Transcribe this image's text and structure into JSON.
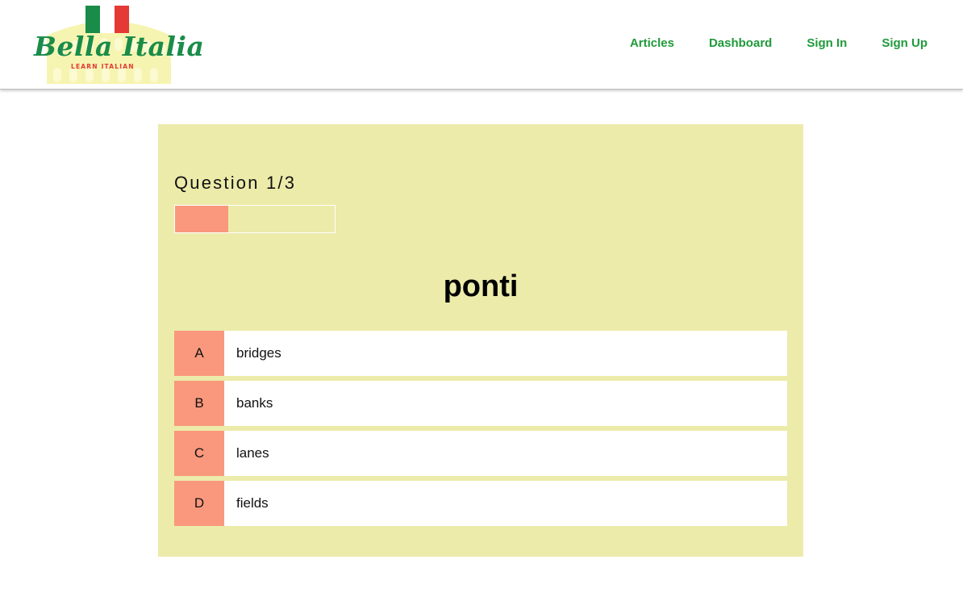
{
  "header": {
    "logo": {
      "title": "Bella Italia",
      "subtitle": "LEARN ITALIAN",
      "flag_colors": [
        "#1a8c4a",
        "#ffffff",
        "#e53935"
      ]
    },
    "nav": [
      {
        "label": "Articles"
      },
      {
        "label": "Dashboard"
      },
      {
        "label": "Sign In"
      },
      {
        "label": "Sign Up"
      }
    ]
  },
  "quiz": {
    "question_label": "Question 1/3",
    "progress": 0.333,
    "word": "ponti",
    "options": [
      {
        "letter": "A",
        "text": "bridges"
      },
      {
        "letter": "B",
        "text": "banks"
      },
      {
        "letter": "C",
        "text": "lanes"
      },
      {
        "letter": "D",
        "text": "fields"
      }
    ]
  },
  "colors": {
    "nav_text": "#1f9a3a",
    "card_bg": "#ecebaa",
    "accent": "#f9987c"
  }
}
